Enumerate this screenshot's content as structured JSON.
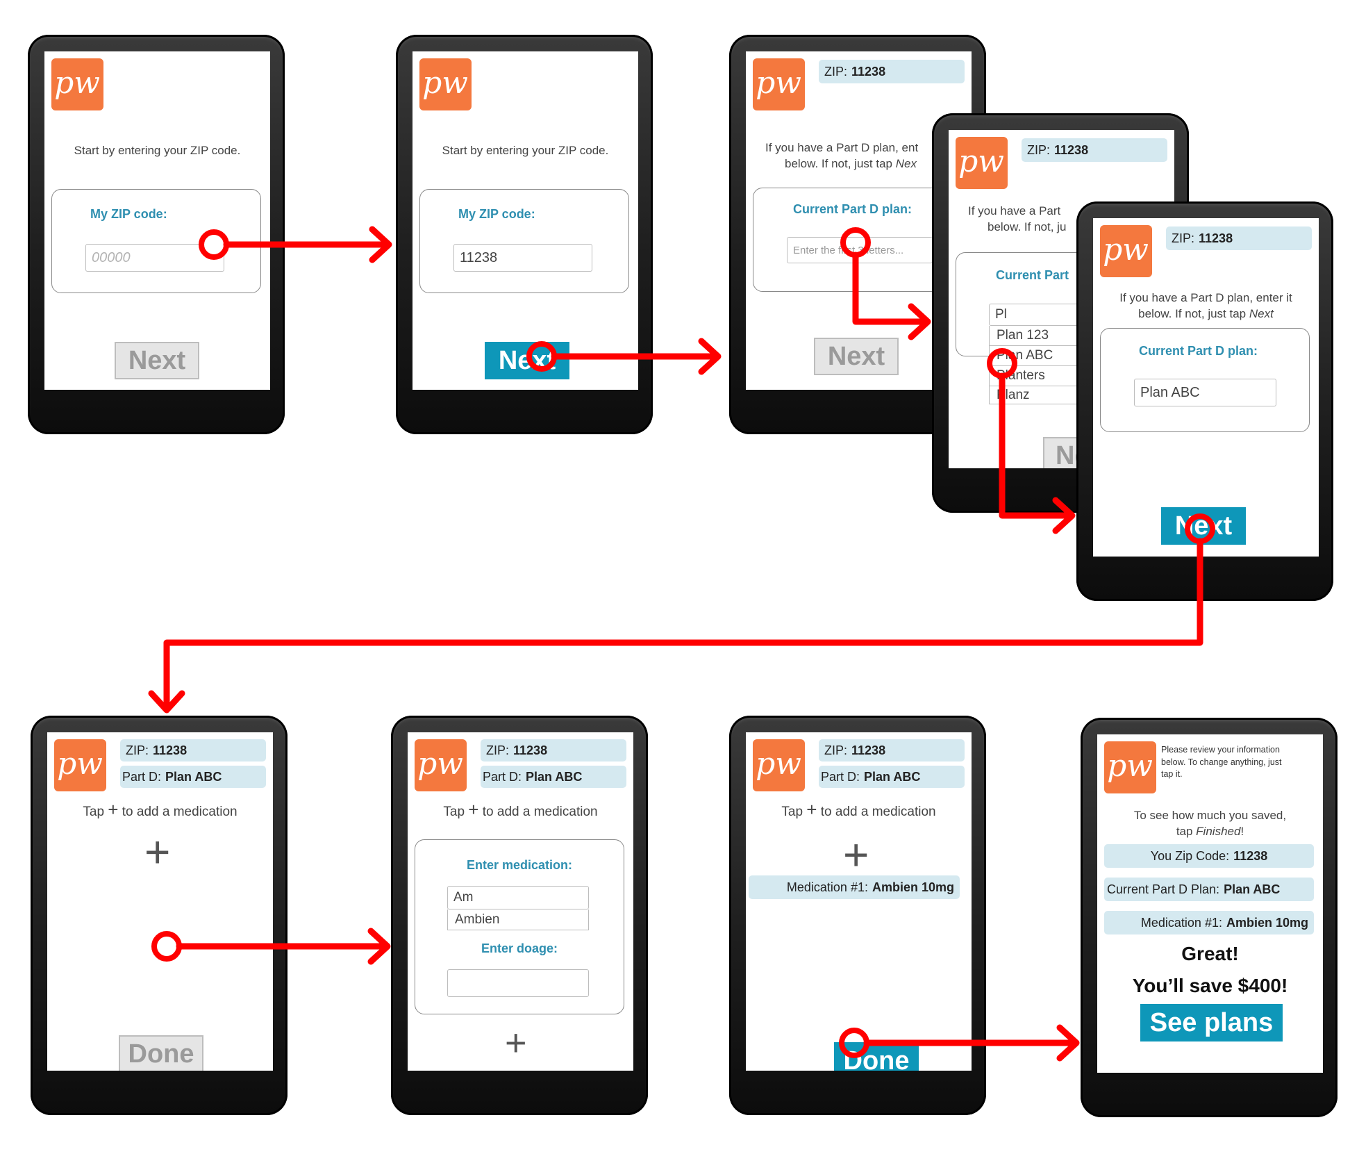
{
  "colors": {
    "accent": "#0e97b9",
    "brand": "#f4783e",
    "label": "#2f8fb0",
    "badge": "#d5e9f0",
    "arrow": "#ff0000"
  },
  "logo_text": "pw",
  "icons": {
    "add": "plus-icon",
    "logo": "pw-logo-icon"
  },
  "s1": {
    "prompt": "Start by entering your ZIP code.",
    "zip_label": "My ZIP code:",
    "zip_placeholder": "00000",
    "next": "Next"
  },
  "s2": {
    "prompt": "Start by entering your ZIP code.",
    "zip_label": "My ZIP code:",
    "zip_value": "11238",
    "next": "Next"
  },
  "s3": {
    "zip_label": "ZIP:",
    "zip": "11238",
    "prompt_l1": "If you have a Part D plan, ent",
    "prompt_l2a": "below. If not, just tap ",
    "prompt_l2b": "Nex",
    "plan_label": "Current Part D plan:",
    "plan_placeholder": "Enter the first 3 letters...",
    "next": "Next"
  },
  "s4": {
    "zip_label": "ZIP:",
    "zip": "11238",
    "prompt_l1": "If you have a Part",
    "prompt_l2": "below. If not, ju",
    "plan_label": "Current Part",
    "input_value": "Pl",
    "options": [
      "Plan 123",
      "Plan ABC",
      "Planters",
      "Planz"
    ],
    "next": "Ne"
  },
  "s5": {
    "zip_label": "ZIP:",
    "zip": "11238",
    "prompt_l1": "If you have a Part D plan, enter it",
    "prompt_l2a": "below. If not, just tap ",
    "prompt_l2b": "Next",
    "plan_label": "Current Part D plan:",
    "plan_value": "Plan ABC",
    "next": "Next"
  },
  "s6": {
    "zip_label": "ZIP:",
    "zip": "11238",
    "part_label": "Part D:",
    "plan": "Plan ABC",
    "tap": "Tap",
    "tap_rest": "to add a medication",
    "done": "Done"
  },
  "s7": {
    "zip_label": "ZIP:",
    "zip": "11238",
    "part_label": "Part D:",
    "plan": "Plan ABC",
    "tap": "Tap",
    "tap_rest": "to add a medication",
    "med_label": "Enter medication:",
    "med_value": "Am",
    "med_option": "Ambien",
    "dose_label": "Enter doage:"
  },
  "s8": {
    "zip_label": "ZIP:",
    "zip": "11238",
    "part_label": "Part D:",
    "plan": "Plan ABC",
    "tap": "Tap",
    "tap_rest": "to add a medication",
    "med_label": "Medication #1:",
    "med": "Ambien 10mg",
    "done": "Done"
  },
  "s9": {
    "review_l1": "Please review your information",
    "review_l2": "below. To change anything, just",
    "review_l3": "tap it.",
    "see_l1": "To see how much you saved,",
    "see_l2a": "tap ",
    "see_l2b": "Finished",
    "see_l2c": "!",
    "zip_label": "You Zip Code:",
    "zip": "11238",
    "plan_label": "Current Part D Plan:",
    "plan": "Plan ABC",
    "med_label": "Medication #1:",
    "med": "Ambien 10mg",
    "great": "Great!",
    "save": "You’ll save $400!",
    "see_plans": "See plans"
  }
}
